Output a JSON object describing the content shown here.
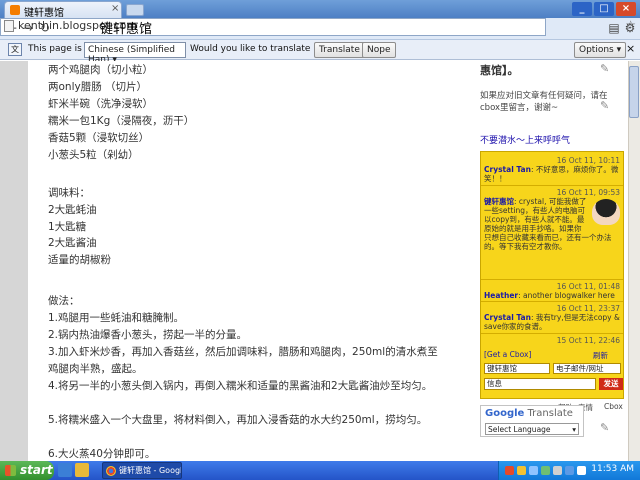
{
  "window": {
    "tab_title": "键轩惠馆",
    "tab_close": "×",
    "newtab": "",
    "minimize": "_",
    "maximize": "□",
    "close": "×"
  },
  "toolbar": {
    "back": "←",
    "forward": "→",
    "reload": "↻",
    "url": "kenthin.blogspot.com",
    "page_title_overlay": "键轩惠馆",
    "star": "☆",
    "page_menu": "⚙"
  },
  "translate_bar": {
    "prefix": "This page is in",
    "language": "Chinese (Simplified Han)",
    "question": "Would you like to translate it?",
    "translate_button": "Translate",
    "nope_button": "Nope",
    "options_button": "Options",
    "close": "×"
  },
  "post": {
    "lines": [
      "两个鸡腿肉（切小粒）",
      "两only腊肠 （切片）",
      "虾米半碗（洗净浸软）",
      "糯米一包1Kg（浸隔夜，沥干）",
      "香菇5颗（浸软切丝）",
      "小葱头5粒（剁幼）",
      "",
      "调味料：",
      "2大匙蚝油",
      "1大匙糖",
      "2大匙酱油",
      "适量的胡椒粉",
      "",
      "做法：",
      "1.鸡腿用一些蚝油和糖腌制。",
      "2.锅内热油爆香小葱头，捞起一半的分量。",
      "3.加入虾米炒香，再加入香菇丝，然后加调味料，腊肠和鸡腿肉，250ml的清水煮至鸡腿肉半熟，盛起。",
      "4.将另一半的小葱头倒入锅内，再倒入糯米和适量的黑酱油和2大匙酱油炒至均匀。",
      "5.将糯米盛入一个大盘里，将材料倒入，再加入浸香菇的水大约250ml，捞均匀。",
      "6.大火蒸40分钟即可。"
    ]
  },
  "sidebar": {
    "top_text": "惠馆】。",
    "note": "如果应对旧文章有任何疑问，请在cbox里留言，谢谢~",
    "cbox_heading": "不要潜水～上来呼呼气",
    "messages": [
      {
        "time": "16 Oct 11, 10:11",
        "who": "Crystal Tan",
        "text": ": 不好意思，麻烦你了。微笑！！"
      },
      {
        "time": "16 Oct 11, 09:53",
        "who": "键轩惠馆",
        "text": ": crystal, 可能我做了一些setting，有些人的电脑可以copy到，有些人就不能。最原始的就是用手抄咯。如果你只想自己收藏来看而已，还有一个办法的。等下我有空才教你。"
      },
      {
        "time": "16 Oct 11, 01:48",
        "who": "Heather",
        "text": ": another blogwalker here"
      },
      {
        "time": "16 Oct 11, 23:37",
        "who": "Crystal Tan",
        "text": ": 我有try,但是无法copy & save你家的食谱。"
      },
      {
        "time": "15 Oct 11, 22:46",
        "who": "",
        "text": ""
      }
    ],
    "get_cbox": "[Get a Cbox]",
    "refresh": "刷新",
    "name_field": "键轩惠馆",
    "email_field": "电子邮件/网址",
    "message_field": "信息",
    "send": "发送",
    "help": "帮助",
    "smileys": "表情",
    "cbox": "Cbox",
    "google_translate_title": "Google Translate",
    "google_brand": "Google",
    "select_language": "Select Language"
  },
  "taskbar": {
    "start": "start",
    "task_item": "键轩惠馆 - Google C...",
    "clock": "11:53 AM"
  },
  "colors": {
    "cbox_bg": "#f7d51b",
    "cbox_name": "#1a1aa8",
    "send_button": "#d02a16",
    "link_blue": "#1a0dab",
    "taskbar_blue": "#2454c8",
    "start_green": "#33902e"
  }
}
